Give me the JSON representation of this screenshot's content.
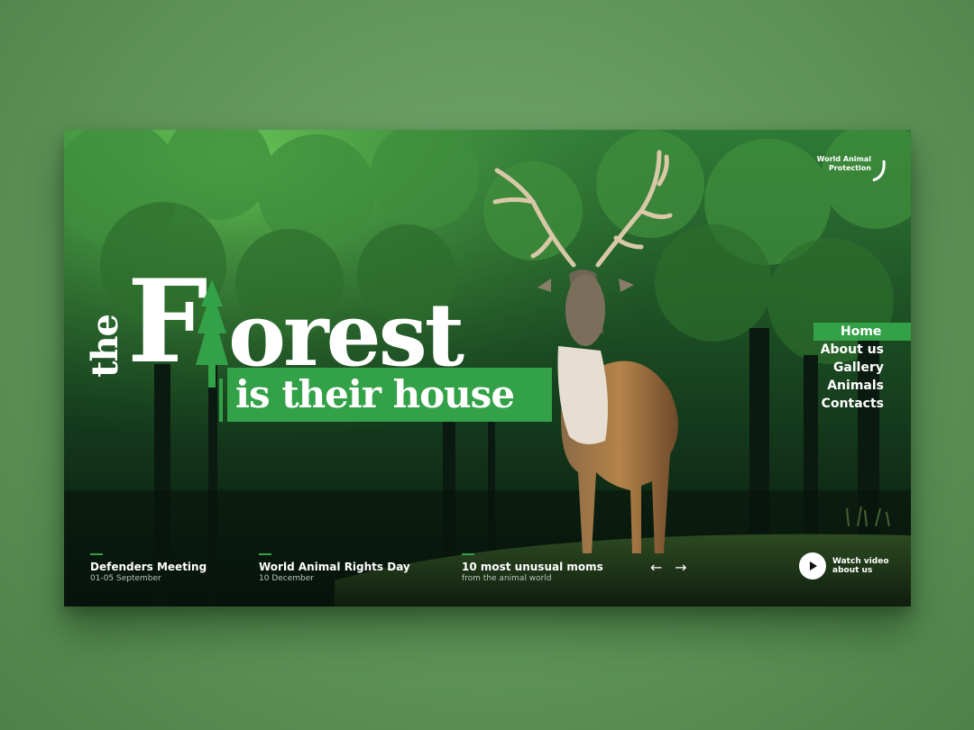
{
  "brand": {
    "line1": "World Animal",
    "line2": "Protection"
  },
  "hero": {
    "the": "the",
    "forest_first": "F",
    "forest_rest": "orest",
    "tagline": "is their house"
  },
  "nav": [
    "Home",
    "About us",
    "Gallery",
    "Animals",
    "Contacts"
  ],
  "nav_active": "Home",
  "news": [
    {
      "title": "Defenders Meeting",
      "subtitle": "01-05 September"
    },
    {
      "title": "World Animal Rights Day",
      "subtitle": "10 December"
    },
    {
      "title": "10 most unusual moms",
      "subtitle": "from the animal world"
    }
  ],
  "arrows": {
    "prev": "←",
    "next": "→"
  },
  "watch": {
    "line1": "Watch video",
    "line2": "about us"
  },
  "colors": {
    "accent": "#32a147",
    "outer_bg": "#64995e"
  },
  "icons": [
    "logo-arc-icon",
    "tree-icon",
    "arrow-left-icon",
    "arrow-right-icon",
    "play-icon"
  ]
}
